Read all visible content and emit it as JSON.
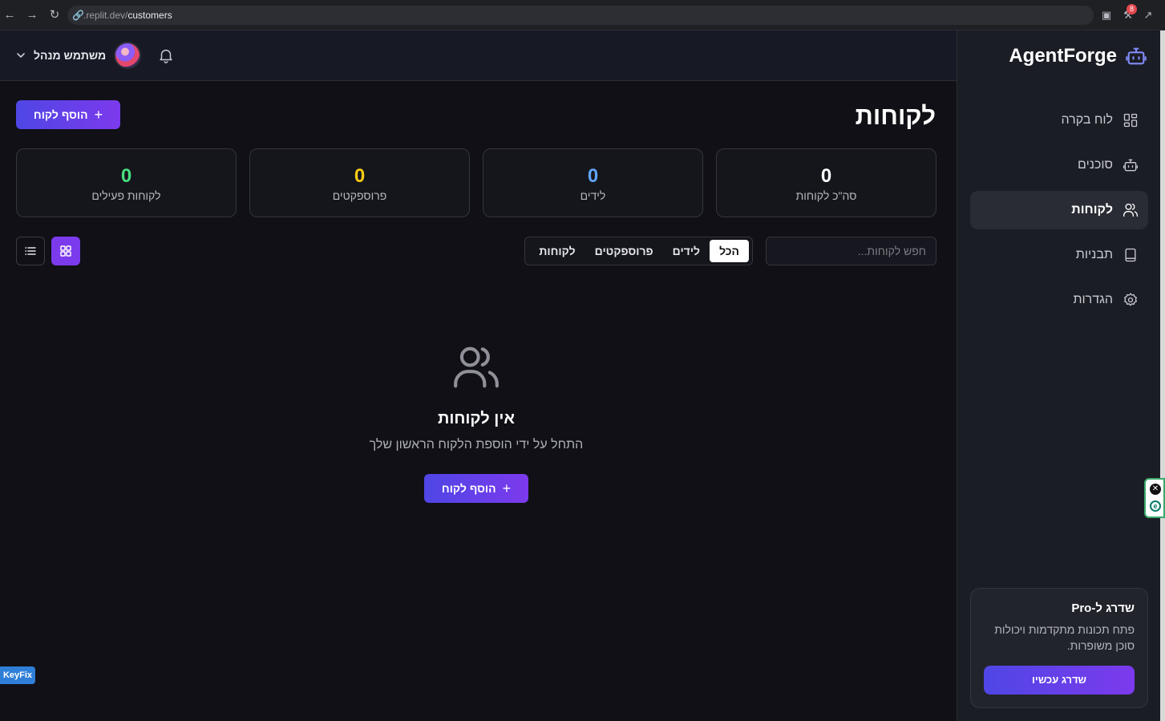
{
  "browser": {
    "url_domain": ".replit.dev/",
    "url_path": "customers",
    "badge_count": "8"
  },
  "sidebar": {
    "brand": "AgentForge",
    "items": [
      {
        "label": "לוח בקרה",
        "icon": "dashboard-icon"
      },
      {
        "label": "סוכנים",
        "icon": "bot-icon"
      },
      {
        "label": "לקוחות",
        "icon": "users-icon",
        "active": true
      },
      {
        "label": "תבניות",
        "icon": "template-icon"
      },
      {
        "label": "הגדרות",
        "icon": "gear-icon"
      }
    ],
    "pro": {
      "title": "שדרג ל-Pro",
      "description": "פתח תכונות מתקדמות ויכולות סוכן משופרות.",
      "button": "שדרג עכשיו"
    }
  },
  "header": {
    "user_name": "משתמש מנהל"
  },
  "main": {
    "title": "לקוחות",
    "add_button": "הוסף לקוח",
    "stats": [
      {
        "label": "סה\"כ לקוחות",
        "value": "0",
        "color": "#ffffff"
      },
      {
        "label": "לידים",
        "value": "0",
        "color": "#60a5fa"
      },
      {
        "label": "פרוספקטים",
        "value": "0",
        "color": "#facc15"
      },
      {
        "label": "לקוחות פעילים",
        "value": "0",
        "color": "#4ade80"
      }
    ],
    "search_placeholder": "חפש לקוחות...",
    "tabs": [
      "הכל",
      "לידים",
      "פרוספקטים",
      "לקוחות"
    ],
    "active_tab": "הכל",
    "empty": {
      "title": "אין לקוחות",
      "description": "התחל על ידי הוספת הלקוח הראשון שלך",
      "button": "הוסף לקוח"
    }
  },
  "overlay": {
    "keyfix": "KeyFix"
  },
  "colors": {
    "accent": "#7c3aed",
    "accent_start": "#4f46e5",
    "background": "#101016",
    "sidebar": "#1b1d24"
  }
}
